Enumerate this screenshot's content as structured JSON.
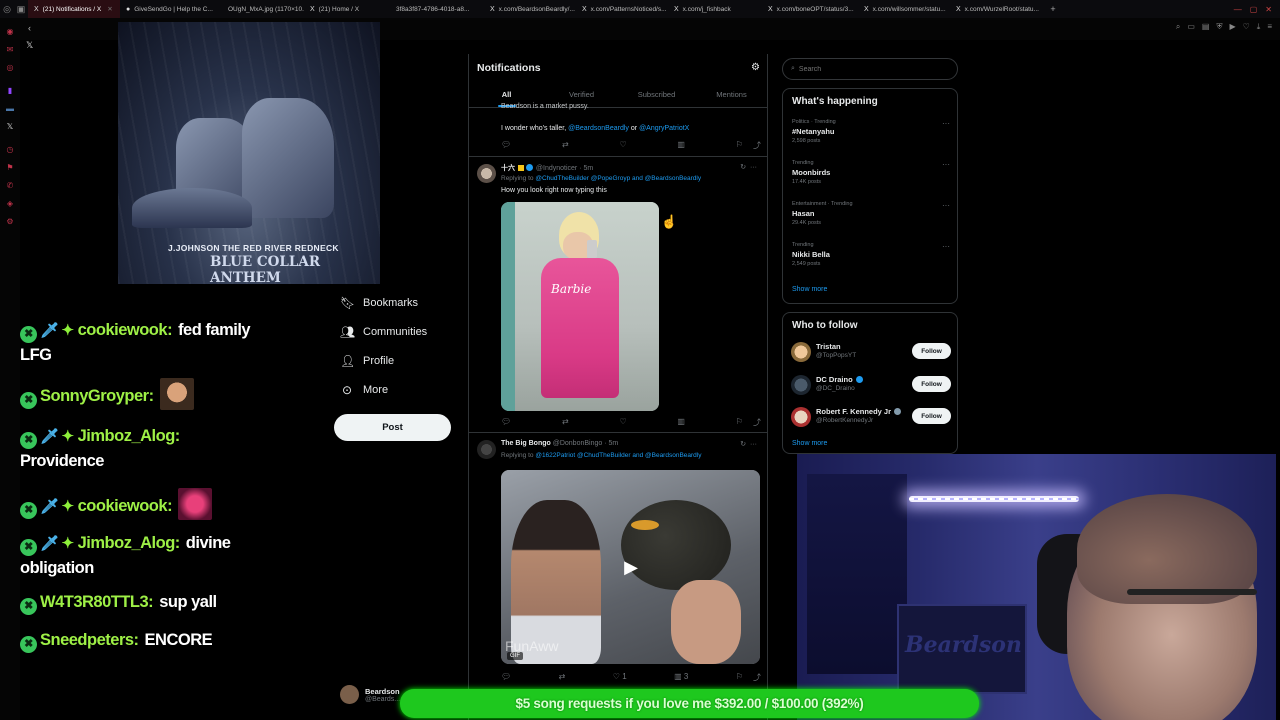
{
  "browser": {
    "tabs": [
      {
        "title": "(21) Notifications / X",
        "favicon": "X",
        "active": true
      },
      {
        "title": "GiveSendGo | Help the C...",
        "favicon": "●",
        "active": false
      },
      {
        "title": "OUgN_MxA.jpg (1170×10...",
        "favicon": "",
        "active": false
      },
      {
        "title": "(21) Home / X",
        "favicon": "X",
        "active": false
      },
      {
        "title": "3f8a3f87-4786-4018-a8...",
        "favicon": "",
        "active": false
      },
      {
        "title": "x.com/BeardsonBeardly/...",
        "favicon": "X",
        "active": false
      },
      {
        "title": "x.com/PatternsNoticed/s...",
        "favicon": "X",
        "active": false
      },
      {
        "title": "x.com/j_fishback",
        "favicon": "X",
        "active": false
      },
      {
        "title": "x.com/boneOPT/status/3...",
        "favicon": "X",
        "active": false
      },
      {
        "title": "x.com/willsommer/statu...",
        "favicon": "X",
        "active": false
      },
      {
        "title": "x.com/WurzelRoot/statu...",
        "favicon": "X",
        "active": false
      }
    ]
  },
  "album": {
    "artist": "J.JOHNSON THE RED RIVER REDNECK",
    "title": "BLUE COLLAR ANTHEM"
  },
  "chat": [
    {
      "user": "cookiewook:",
      "msg": "fed family",
      "msg2": "LFG",
      "sword": true,
      "gem": true
    },
    {
      "user": "SonnyGroyper:",
      "msg": "",
      "emote": "face-emote",
      "sword": false,
      "gem": false
    },
    {
      "user": "Jimboz_Alog:",
      "msg": "",
      "msg2": "Providence",
      "sword": true,
      "gem": true
    },
    {
      "user": "cookiewook:",
      "msg": "",
      "emote": "pink-emote",
      "sword": true,
      "gem": true
    },
    {
      "user": "Jimboz_Alog:",
      "msg": "divine",
      "msg2": "obligation",
      "sword": true,
      "gem": true
    },
    {
      "user": "W4T3R80TTL3:",
      "msg": "sup yall",
      "sword": false,
      "gem": false
    },
    {
      "user": "Sneedpeters:",
      "msg": "ENCORE",
      "sword": false,
      "gem": false
    }
  ],
  "nav": {
    "bookmarks": "Bookmarks",
    "communities": "Communities",
    "profile": "Profile",
    "more": "More",
    "post": "Post",
    "account_name": "Beardson",
    "account_handle": "@Beards..."
  },
  "notifications": {
    "title": "Notifications",
    "tabs": [
      "All",
      "Verified",
      "Subscribed",
      "Mentions"
    ],
    "prev_tweet": {
      "cut_line": "Beardson is a market pussy.",
      "line": "I wonder who's taller,",
      "mention1": "@BeardsonBeardly",
      "or": "or",
      "mention2": "@AngryPatriotX"
    },
    "tweet1": {
      "name": "十六",
      "handle": "@Indynoticer · 5m",
      "replying_label": "Replying to",
      "replying_mentions": "@ChudTheBuilder @PopeGroyp and @BeardsonBeardly",
      "text": "How you look right now typing this"
    },
    "tweet2": {
      "name": "The Big Bongo",
      "handle": "@DonbonBingo · 5m",
      "replying_label": "Replying to",
      "replying_mentions": "@1622Patriot @ChudTheBuilder and @BeardsonBeardly",
      "watermark": "FunAww",
      "gif": "GIF",
      "likes": "1",
      "views": "3"
    }
  },
  "right": {
    "search_placeholder": "Search",
    "happening_title": "What's happening",
    "trends": [
      {
        "context": "Politics · Trending",
        "name": "#Netanyahu",
        "posts": "2,598 posts"
      },
      {
        "context": "Trending",
        "name": "Moonbirds",
        "posts": "17.4K posts"
      },
      {
        "context": "Entertainment · Trending",
        "name": "Hasan",
        "posts": "29.4K posts"
      },
      {
        "context": "Trending",
        "name": "Nikki Bella",
        "posts": "2,549 posts"
      }
    ],
    "show_more": "Show more",
    "wtf_title": "Who to follow",
    "follow_label": "Follow",
    "who_to_follow": [
      {
        "name": "Tristan",
        "handle": "@TopPopsYT",
        "verified": false
      },
      {
        "name": "DC Draino",
        "handle": "@DC_Draino",
        "verified": true
      },
      {
        "name": "Robert F. Kennedy Jr",
        "handle": "@RobertKennedyJr",
        "verified": true
      }
    ],
    "wtf_show_more": "Show more"
  },
  "webcam": {
    "poster_text": "Beardson"
  },
  "banner": {
    "text": "$5 song requests if you love me $392.00 / $100.00 (392%)"
  },
  "colors": {
    "x_blue": "#1d9bf0",
    "chat_username": "#9ef046",
    "banner_green": "#1ec81e"
  }
}
